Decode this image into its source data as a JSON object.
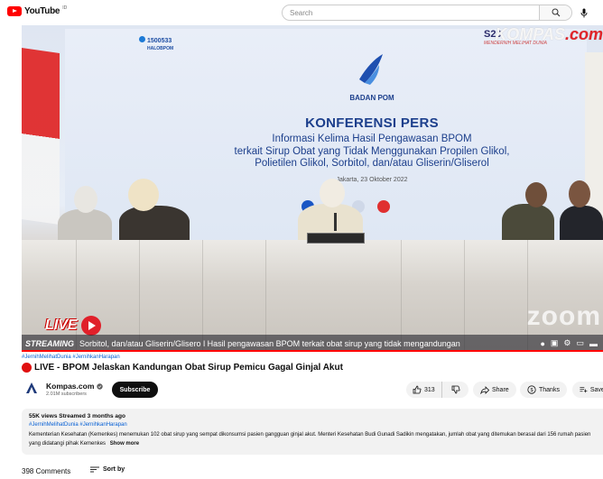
{
  "header": {
    "logo_text": "YouTube",
    "logo_region": "ID",
    "search_placeholder": "Search"
  },
  "video": {
    "slide": {
      "hotline_number": "1500533",
      "hotline_label": "HALOBPOM",
      "logo_name": "BADAN POM",
      "heading": "KONFERENSI PERS",
      "line1": "Informasi Kelima Hasil Pengawasan BPOM",
      "line2": "terkait Sirup Obat yang Tidak Menggunakan Propilen Glikol,",
      "line3": "Polietilen Glikol, Sorbitol, dan/atau Gliserin/Gliserol",
      "date": "Jakarta, 23 Oktober 2022"
    },
    "event_badge": "S20",
    "event_sub": "MENDERNIH MELIHAT DUNIA",
    "kompas_watermark": "KOMPAS",
    "kompas_watermark_suffix": ".com",
    "live_label": "LIVE",
    "zoom_watermark": "zoom",
    "ticker_stream": "STREAMING",
    "ticker_text": "Sorbitol, dan/atau Gliserin/Glisero l Hasil pengawasan BPOM terkait obat sirup yang tidak mengandungan",
    "progress": 1.0,
    "colors": {
      "live_red": "#e0202a",
      "progress": "#ff0000"
    }
  },
  "meta": {
    "top_tags": "#JernihMelihatDunia #JernihkanHarapan",
    "title": "LIVE - BPOM Jelaskan Kandungan Obat Sirup Pemicu Gagal Ginjal Akut",
    "channel_name": "Kompas.com",
    "subscribers": "2.01M subscribers",
    "subscribe_label": "Subscribe",
    "likes": "313",
    "share_label": "Share",
    "thanks_label": "Thanks",
    "save_label": "Save"
  },
  "description": {
    "stats": "55K views  Streamed 3 months ago",
    "tags": "#JernihMelihatDunia #JernihkanHarapan",
    "text": "Kementerian Kesehatan (Kemenkes) menemukan 102 obat sirup yang sempat dikonsumsi pasien gangguan ginjal akut. Menteri Kesehatan Budi Gunadi Sadikin mengatakan, jumlah obat yang ditemukan berasal dari 156 rumah pasien yang didatangi pihak Kemenkes",
    "show_more": "Show more"
  },
  "comments": {
    "count": "398 Comments",
    "sort_label": "Sort by"
  }
}
